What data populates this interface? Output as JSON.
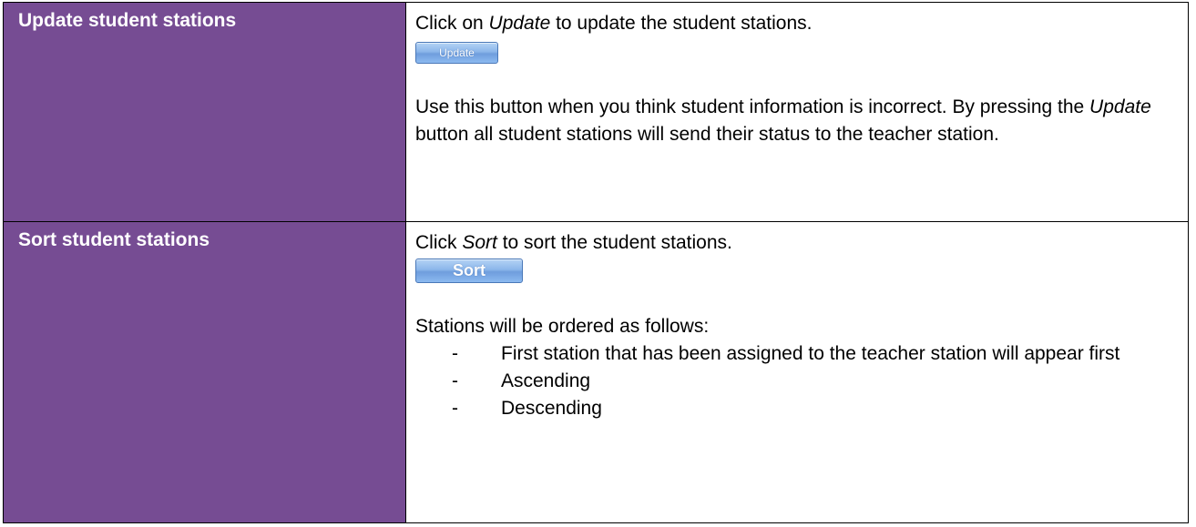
{
  "sections": [
    {
      "title": "Update student stations",
      "intro_prefix": "Click on ",
      "intro_em": "Update",
      "intro_suffix": " to update the student stations.",
      "button_label": "Update",
      "desc_prefix": "Use this button when you think student information is incorrect. By pressing the ",
      "desc_em": "Update",
      "desc_suffix": " button all student stations will send their status to the teacher station."
    },
    {
      "title": "Sort student stations",
      "intro_prefix": "Click ",
      "intro_em": "Sort",
      "intro_suffix": " to sort the student stations.",
      "button_label": "Sort",
      "desc": "Stations will be ordered as follows:",
      "bullets": [
        "First station that has been assigned to the teacher station will appear first",
        "Ascending",
        "Descending"
      ],
      "bullet_marker": "-"
    }
  ],
  "colors": {
    "label_bg": "#764c93",
    "label_text": "#ffffff",
    "button_blue": "#8bb6ea"
  }
}
